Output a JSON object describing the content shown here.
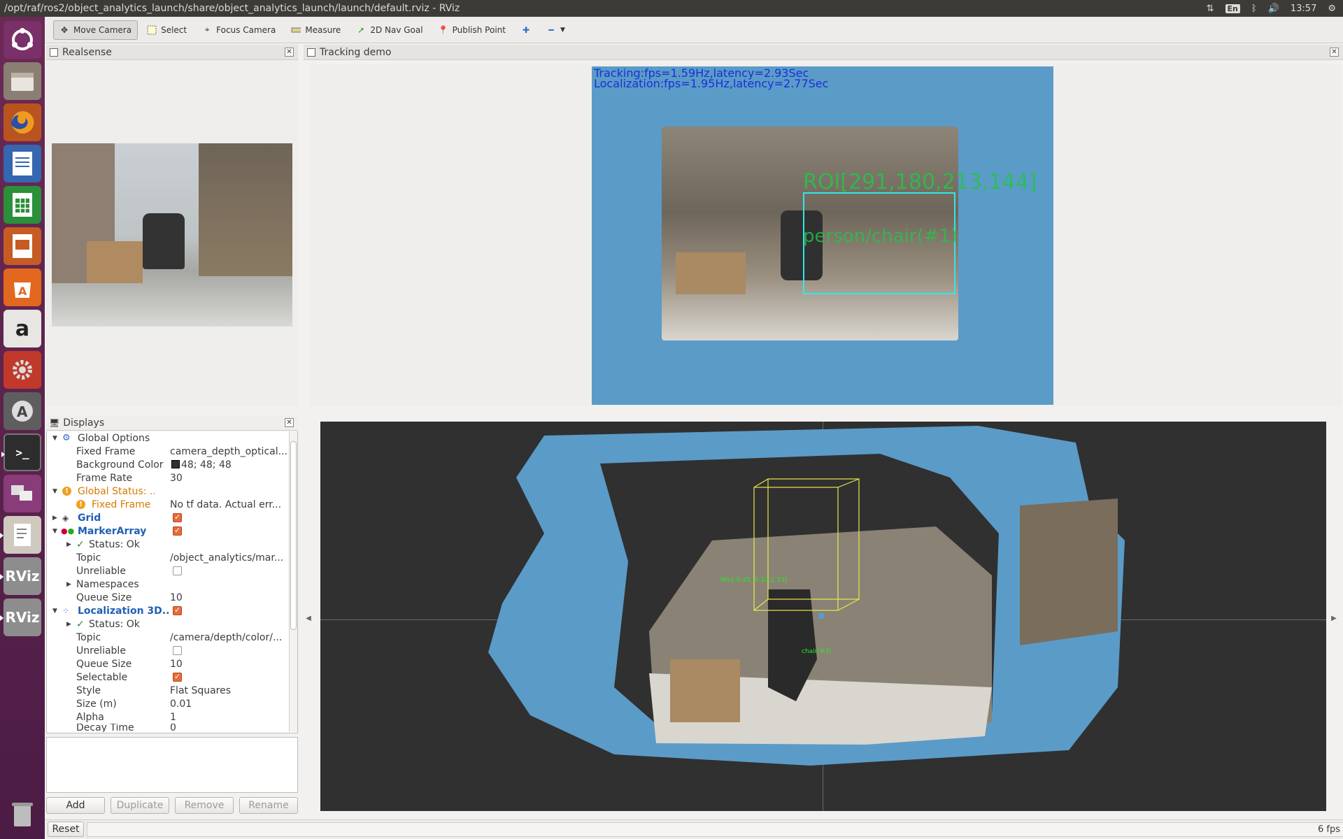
{
  "window": {
    "title": "/opt/raf/ros2/object_analytics_launch/share/object_analytics_launch/launch/default.rviz - RViz"
  },
  "tray": {
    "lang": "En",
    "time": "13:57"
  },
  "toolbar": {
    "move_camera": "Move Camera",
    "select": "Select",
    "focus_camera": "Focus Camera",
    "measure": "Measure",
    "nav_goal": "2D Nav Goal",
    "publish_point": "Publish Point"
  },
  "realsense_panel": {
    "title": "Realsense"
  },
  "tracking_panel": {
    "title": "Tracking demo",
    "overlay_line1": "Tracking:fps=1.59Hz,latency=2.93Sec",
    "overlay_line2": "Localization:fps=1.95Hz,latency=2.77Sec",
    "roi_label": "ROI[291,180,213,144]",
    "object_label": "person/chair(#1)"
  },
  "displays": {
    "title": "Displays",
    "rows": [
      {
        "name": "Global Options",
        "value": ""
      },
      {
        "name": "Fixed Frame",
        "value": "camera_depth_optical..."
      },
      {
        "name": "Background Color",
        "value": "48; 48; 48"
      },
      {
        "name": "Frame Rate",
        "value": "30"
      },
      {
        "name": "Global Status: ...",
        "value": ""
      },
      {
        "name": "Fixed Frame",
        "value": "No tf data.  Actual err..."
      },
      {
        "name": "Grid",
        "value": ""
      },
      {
        "name": "MarkerArray",
        "value": ""
      },
      {
        "name": "Status: Ok",
        "value": ""
      },
      {
        "name": "Topic",
        "value": "/object_analytics/mar..."
      },
      {
        "name": "Unreliable",
        "value": ""
      },
      {
        "name": "Namespaces",
        "value": ""
      },
      {
        "name": "Queue Size",
        "value": "10"
      },
      {
        "name": "Localization 3D...",
        "value": ""
      },
      {
        "name": "Status: Ok",
        "value": ""
      },
      {
        "name": "Topic",
        "value": "/camera/depth/color/..."
      },
      {
        "name": "Unreliable",
        "value": ""
      },
      {
        "name": "Queue Size",
        "value": "10"
      },
      {
        "name": "Selectable",
        "value": ""
      },
      {
        "name": "Style",
        "value": "Flat Squares"
      },
      {
        "name": "Size (m)",
        "value": "0.01"
      },
      {
        "name": "Alpha",
        "value": "1"
      },
      {
        "name": "Decay Time",
        "value": "0"
      }
    ],
    "buttons": {
      "add": "Add",
      "duplicate": "Duplicate",
      "remove": "Remove",
      "rename": "Rename"
    }
  },
  "view3d": {
    "min_label": "Min[-0.45,-0.22,2.13]",
    "object_label": "chair(#3)"
  },
  "statusbar": {
    "reset": "Reset",
    "fps": "6 fps"
  },
  "colors": {
    "accent": "#e86a3a",
    "cloud_blue": "#5b9bc8",
    "bg3d": "#303030",
    "launcher": "#5a2150"
  }
}
